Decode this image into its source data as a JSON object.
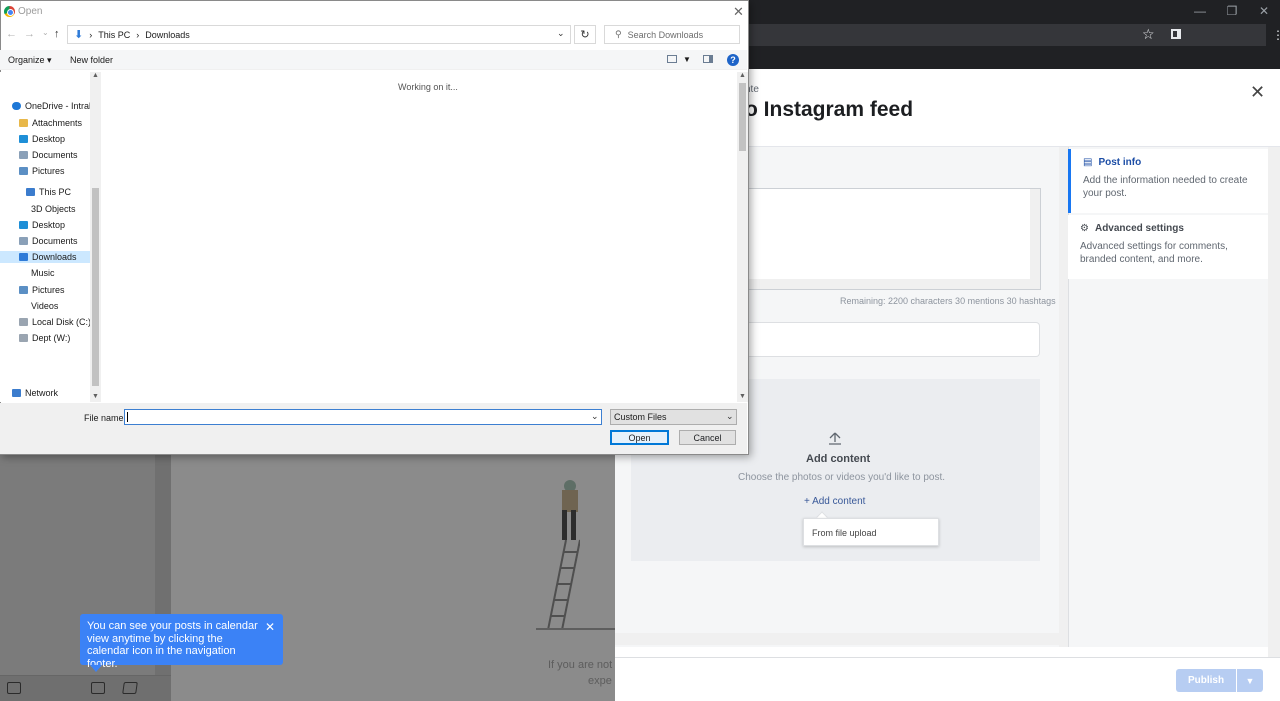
{
  "browser": {
    "window_controls": [
      "—",
      "❐",
      "✕"
    ],
    "star_glyph": "☆",
    "more_glyph": "⋮"
  },
  "background_app": {
    "tooltip": {
      "text": "You can see your posts in calendar view anytime by clicking the calendar icon in the navigation footer.",
      "close_glyph": "✕"
    },
    "hint_lines": [
      "If you are not s",
      "expe"
    ]
  },
  "composer": {
    "breadcrumb": "nte",
    "title": "o Instagram feed",
    "close_glyph": "✕",
    "remaining": "Remaining: 2200 characters 30 mentions 30 hashtags",
    "add_content": {
      "title": "Add content",
      "subtitle": "Choose the photos or videos you'd like to post.",
      "link_label": "+ Add content",
      "menu_item": "From file upload"
    },
    "side": {
      "post_info": {
        "title": "Post info",
        "desc": "Add the information needed to create your post."
      },
      "advanced": {
        "title": "Advanced settings",
        "desc": "Advanced settings for comments, branded content, and more."
      }
    },
    "publish_label": "Publish"
  },
  "dialog": {
    "title": "Open",
    "close_glyph": "✕",
    "address": [
      "This PC",
      "Downloads"
    ],
    "search_placeholder": "Search Downloads",
    "organize_label": "Organize ▾",
    "new_folder_label": "New folder",
    "help_glyph": "?",
    "status_text": "Working on it...",
    "tree": [
      {
        "label": "OneDrive - Intralin",
        "icon": "cloud-icon",
        "color": "#1e78d7"
      },
      {
        "label": "Attachments",
        "icon": "folder-icon",
        "color": "#e8b84a"
      },
      {
        "label": "Desktop",
        "icon": "desktop-icon",
        "color": "#1e8fd7"
      },
      {
        "label": "Documents",
        "icon": "documents-icon",
        "color": "#8aa0b8"
      },
      {
        "label": "Pictures",
        "icon": "pictures-icon",
        "color": "#5b8fc4"
      },
      {
        "label": "This PC",
        "icon": "computer-icon",
        "color": "#3b7ccd"
      },
      {
        "label": "3D Objects",
        "icon": "cube-icon",
        "color": "#6bb3e6"
      },
      {
        "label": "Desktop",
        "icon": "desktop-icon",
        "color": "#1e8fd7"
      },
      {
        "label": "Documents",
        "icon": "documents-icon",
        "color": "#8aa0b8"
      },
      {
        "label": "Downloads",
        "icon": "download-icon",
        "color": "#2f7bd8"
      },
      {
        "label": "Music",
        "icon": "music-icon",
        "color": "#4a90d9"
      },
      {
        "label": "Pictures",
        "icon": "pictures-icon",
        "color": "#5b8fc4"
      },
      {
        "label": "Videos",
        "icon": "videos-icon",
        "color": "#4a7ab8"
      },
      {
        "label": "Local Disk (C:)",
        "icon": "drive-icon",
        "color": "#9aa5b1"
      },
      {
        "label": "Dept (W:)",
        "icon": "drive-icon",
        "color": "#9aa5b1"
      },
      {
        "label": "Network",
        "icon": "network-icon",
        "color": "#3b7ccd"
      }
    ],
    "filename_label": "File name:",
    "filter_value": "Custom Files",
    "open_label": "Open",
    "cancel_label": "Cancel"
  }
}
